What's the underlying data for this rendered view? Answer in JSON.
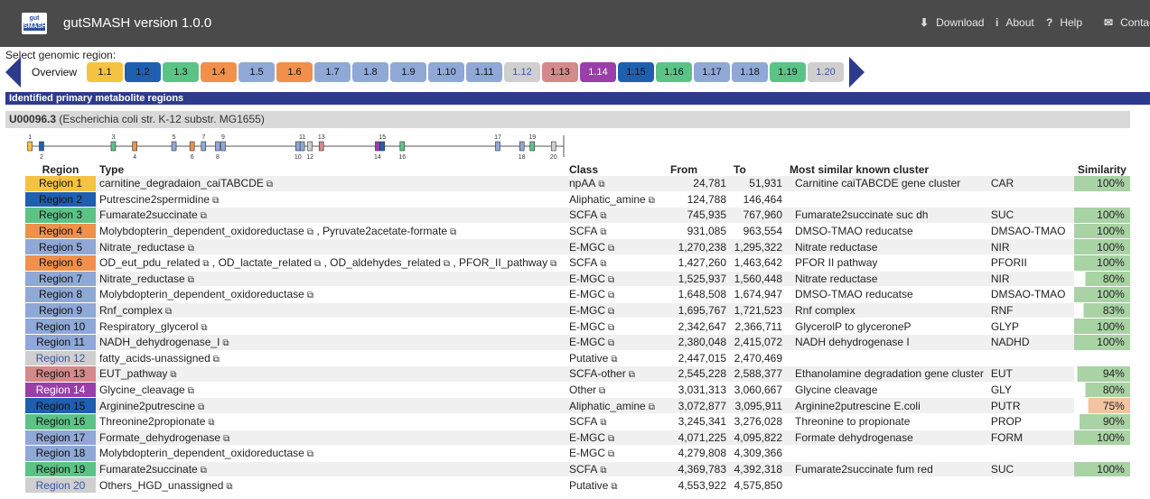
{
  "header": {
    "logo_line1": "gut",
    "logo_line2": "SMASH",
    "title": "gutSMASH version 1.0.0",
    "nav": [
      {
        "icon": "download-icon",
        "glyph": "⬇",
        "label": "Download"
      },
      {
        "icon": "info-icon",
        "glyph": "i",
        "label": "About"
      },
      {
        "icon": "help-icon",
        "glyph": "?",
        "label": "Help"
      },
      {
        "icon": "mail-icon",
        "glyph": "✉",
        "label": "Contact"
      }
    ]
  },
  "selector": {
    "label": "Select genomic region:",
    "overview_label": "Overview",
    "regions": [
      {
        "label": "1.1",
        "color": "#f5c242",
        "text": "#111"
      },
      {
        "label": "1.2",
        "color": "#1f5fb0",
        "text": "#111"
      },
      {
        "label": "1.3",
        "color": "#5cc386",
        "text": "#111"
      },
      {
        "label": "1.4",
        "color": "#f0904a",
        "text": "#111"
      },
      {
        "label": "1.5",
        "color": "#8fa8d6",
        "text": "#111"
      },
      {
        "label": "1.6",
        "color": "#f0904a",
        "text": "#111"
      },
      {
        "label": "1.7",
        "color": "#8fa8d6",
        "text": "#111"
      },
      {
        "label": "1.8",
        "color": "#8fa8d6",
        "text": "#111"
      },
      {
        "label": "1.9",
        "color": "#8fa8d6",
        "text": "#111"
      },
      {
        "label": "1.10",
        "color": "#8fa8d6",
        "text": "#111"
      },
      {
        "label": "1.11",
        "color": "#8fa8d6",
        "text": "#111"
      },
      {
        "label": "1.12",
        "color": "#cfcfcf",
        "text": "#3a55a8"
      },
      {
        "label": "1.13",
        "color": "#d4898a",
        "text": "#111"
      },
      {
        "label": "1.14",
        "color": "#9a3ea8",
        "text": "#fff"
      },
      {
        "label": "1.15",
        "color": "#1f5fb0",
        "text": "#111"
      },
      {
        "label": "1.16",
        "color": "#5cc386",
        "text": "#111"
      },
      {
        "label": "1.17",
        "color": "#8fa8d6",
        "text": "#111"
      },
      {
        "label": "1.18",
        "color": "#8fa8d6",
        "text": "#111"
      },
      {
        "label": "1.19",
        "color": "#5cc386",
        "text": "#111"
      },
      {
        "label": "1.20",
        "color": "#cfcfcf",
        "text": "#3a55a8"
      }
    ]
  },
  "section_title": "Identified primary metabolite regions",
  "record": {
    "accession": "U00096.3",
    "description": "(Escherichia coli str. K-12 substr. MG1655)"
  },
  "overview": {
    "genome_length": 4641652,
    "markers": [
      {
        "label": "1",
        "start": 24781,
        "color": "#f5c242",
        "row": "top"
      },
      {
        "label": "2",
        "start": 124788,
        "color": "#1f5fb0",
        "row": "bottom"
      },
      {
        "label": "3",
        "start": 745935,
        "color": "#5cc386",
        "row": "top"
      },
      {
        "label": "4",
        "start": 931085,
        "color": "#f0904a",
        "row": "bottom"
      },
      {
        "label": "5",
        "start": 1270238,
        "color": "#8fa8d6",
        "row": "top"
      },
      {
        "label": "6",
        "start": 1427260,
        "color": "#f0904a",
        "row": "bottom"
      },
      {
        "label": "7",
        "start": 1525937,
        "color": "#8fa8d6",
        "row": "top"
      },
      {
        "label": "8",
        "start": 1648508,
        "color": "#8fa8d6",
        "row": "bottom"
      },
      {
        "label": "9",
        "start": 1695767,
        "color": "#8fa8d6",
        "row": "top"
      },
      {
        "label": "10",
        "start": 2342647,
        "color": "#8fa8d6",
        "row": "bottom"
      },
      {
        "label": "11",
        "start": 2380048,
        "color": "#8fa8d6",
        "row": "top"
      },
      {
        "label": "12",
        "start": 2447015,
        "color": "#cfcfcf",
        "row": "bottom"
      },
      {
        "label": "13",
        "start": 2545228,
        "color": "#d4898a",
        "row": "top"
      },
      {
        "label": "14",
        "start": 3031313,
        "color": "#9a3ea8",
        "row": "bottom"
      },
      {
        "label": "15",
        "start": 3072877,
        "color": "#1f5fb0",
        "row": "top"
      },
      {
        "label": "16",
        "start": 3245341,
        "color": "#5cc386",
        "row": "bottom"
      },
      {
        "label": "17",
        "start": 4071225,
        "color": "#8fa8d6",
        "row": "top"
      },
      {
        "label": "18",
        "start": 4279808,
        "color": "#8fa8d6",
        "row": "bottom"
      },
      {
        "label": "19",
        "start": 4369783,
        "color": "#5cc386",
        "row": "top"
      },
      {
        "label": "20",
        "start": 4553922,
        "color": "#cfcfcf",
        "row": "bottom"
      }
    ]
  },
  "table": {
    "columns": [
      "Region",
      "Type",
      "Class",
      "From",
      "To",
      "Most similar known cluster",
      "",
      "Similarity"
    ],
    "rows": [
      {
        "region": "Region 1",
        "color": "#f5c242",
        "text": "#111",
        "types": [
          "carnitine_degradaion_caiTABCDE"
        ],
        "class": "npAA",
        "from": "24,781",
        "to": "51,931",
        "cluster": "Carnitine caiTABCDE gene cluster",
        "abbr": "CAR",
        "similarity": "100%",
        "sim_value": 100
      },
      {
        "region": "Region 2",
        "color": "#1f5fb0",
        "text": "#111",
        "types": [
          "Putrescine2spermidine"
        ],
        "class": "Aliphatic_amine",
        "from": "124,788",
        "to": "146,464",
        "cluster": "",
        "abbr": "",
        "similarity": "",
        "sim_value": 0
      },
      {
        "region": "Region 3",
        "color": "#5cc386",
        "text": "#111",
        "types": [
          "Fumarate2succinate"
        ],
        "class": "SCFA",
        "from": "745,935",
        "to": "767,960",
        "cluster": "Fumarate2succinate suc dh",
        "abbr": "SUC",
        "similarity": "100%",
        "sim_value": 100
      },
      {
        "region": "Region 4",
        "color": "#f0904a",
        "text": "#111",
        "types": [
          "Molybdopterin_dependent_oxidoreductase",
          "Pyruvate2acetate-formate"
        ],
        "class": "SCFA",
        "from": "931,085",
        "to": "963,554",
        "cluster": "DMSO-TMAO reducatse",
        "abbr": "DMSAO-TMAO",
        "similarity": "100%",
        "sim_value": 100
      },
      {
        "region": "Region 5",
        "color": "#8fa8d6",
        "text": "#111",
        "types": [
          "Nitrate_reductase"
        ],
        "class": "E-MGC",
        "from": "1,270,238",
        "to": "1,295,322",
        "cluster": "Nitrate reductase",
        "abbr": "NIR",
        "similarity": "100%",
        "sim_value": 100
      },
      {
        "region": "Region 6",
        "color": "#f0904a",
        "text": "#111",
        "types": [
          "OD_eut_pdu_related",
          "OD_lactate_related",
          "OD_aldehydes_related",
          "PFOR_II_pathway"
        ],
        "class": "SCFA",
        "from": "1,427,260",
        "to": "1,463,642",
        "cluster": "PFOR II pathway",
        "abbr": "PFORII",
        "similarity": "100%",
        "sim_value": 100
      },
      {
        "region": "Region 7",
        "color": "#8fa8d6",
        "text": "#111",
        "types": [
          "Nitrate_reductase"
        ],
        "class": "E-MGC",
        "from": "1,525,937",
        "to": "1,560,448",
        "cluster": "Nitrate reductase",
        "abbr": "NIR",
        "similarity": "80%",
        "sim_value": 80
      },
      {
        "region": "Region 8",
        "color": "#8fa8d6",
        "text": "#111",
        "types": [
          "Molybdopterin_dependent_oxidoreductase"
        ],
        "class": "E-MGC",
        "from": "1,648,508",
        "to": "1,674,947",
        "cluster": "DMSO-TMAO reducatse",
        "abbr": "DMSAO-TMAO",
        "similarity": "100%",
        "sim_value": 100
      },
      {
        "region": "Region 9",
        "color": "#8fa8d6",
        "text": "#111",
        "types": [
          "Rnf_complex"
        ],
        "class": "E-MGC",
        "from": "1,695,767",
        "to": "1,721,523",
        "cluster": "Rnf complex",
        "abbr": "RNF",
        "similarity": "83%",
        "sim_value": 83
      },
      {
        "region": "Region 10",
        "color": "#8fa8d6",
        "text": "#111",
        "types": [
          "Respiratory_glycerol"
        ],
        "class": "E-MGC",
        "from": "2,342,647",
        "to": "2,366,711",
        "cluster": "GlycerolP to glyceroneP",
        "abbr": "GLYP",
        "similarity": "100%",
        "sim_value": 100
      },
      {
        "region": "Region 11",
        "color": "#8fa8d6",
        "text": "#111",
        "types": [
          "NADH_dehydrogenase_I"
        ],
        "class": "E-MGC",
        "from": "2,380,048",
        "to": "2,415,072",
        "cluster": "NADH dehydrogenase I",
        "abbr": "NADHD",
        "similarity": "100%",
        "sim_value": 100
      },
      {
        "region": "Region 12",
        "color": "#cfcfcf",
        "text": "#3a55a8",
        "types": [
          "fatty_acids-unassigned"
        ],
        "class": "Putative",
        "from": "2,447,015",
        "to": "2,470,469",
        "cluster": "",
        "abbr": "",
        "similarity": "",
        "sim_value": 0
      },
      {
        "region": "Region 13",
        "color": "#d4898a",
        "text": "#111",
        "types": [
          "EUT_pathway"
        ],
        "class": "SCFA-other",
        "from": "2,545,228",
        "to": "2,588,377",
        "cluster": "Ethanolamine degradation gene cluster",
        "abbr": "EUT",
        "similarity": "94%",
        "sim_value": 94
      },
      {
        "region": "Region 14",
        "color": "#9a3ea8",
        "text": "#fff",
        "types": [
          "Glycine_cleavage"
        ],
        "class": "Other",
        "from": "3,031,313",
        "to": "3,060,667",
        "cluster": "Glycine cleavage",
        "abbr": "GLY",
        "similarity": "80%",
        "sim_value": 80
      },
      {
        "region": "Region 15",
        "color": "#1f5fb0",
        "text": "#111",
        "types": [
          "Arginine2putrescine"
        ],
        "class": "Aliphatic_amine",
        "from": "3,072,877",
        "to": "3,095,911",
        "cluster": "Arginine2putrescine E.coli",
        "abbr": "PUTR",
        "similarity": "75%",
        "sim_value": 75
      },
      {
        "region": "Region 16",
        "color": "#5cc386",
        "text": "#111",
        "types": [
          "Threonine2propionate"
        ],
        "class": "SCFA",
        "from": "3,245,341",
        "to": "3,276,028",
        "cluster": "Threonine to propionate",
        "abbr": "PROP",
        "similarity": "90%",
        "sim_value": 90
      },
      {
        "region": "Region 17",
        "color": "#8fa8d6",
        "text": "#111",
        "types": [
          "Formate_dehydrogenase"
        ],
        "class": "E-MGC",
        "from": "4,071,225",
        "to": "4,095,822",
        "cluster": "Formate dehydrogenase",
        "abbr": "FORM",
        "similarity": "100%",
        "sim_value": 100
      },
      {
        "region": "Region 18",
        "color": "#8fa8d6",
        "text": "#111",
        "types": [
          "Molybdopterin_dependent_oxidoreductase"
        ],
        "class": "E-MGC",
        "from": "4,279,808",
        "to": "4,309,366",
        "cluster": "",
        "abbr": "",
        "similarity": "",
        "sim_value": 0
      },
      {
        "region": "Region 19",
        "color": "#5cc386",
        "text": "#111",
        "types": [
          "Fumarate2succinate"
        ],
        "class": "SCFA",
        "from": "4,369,783",
        "to": "4,392,318",
        "cluster": "Fumarate2succinate fum red",
        "abbr": "SUC",
        "similarity": "100%",
        "sim_value": 100
      },
      {
        "region": "Region 20",
        "color": "#cfcfcf",
        "text": "#3a55a8",
        "types": [
          "Others_HGD_unassigned"
        ],
        "class": "Putative",
        "from": "4,553,922",
        "to": "4,575,850",
        "cluster": "",
        "abbr": "",
        "similarity": "",
        "sim_value": 0
      }
    ]
  },
  "colors": {
    "header_bg": "#4a4a4a",
    "nav_arrow": "#2d3b8c",
    "section_bar": "#2e3a8c",
    "similarity_high": "#a9d3a4",
    "similarity_low": "#f2c4a3"
  }
}
